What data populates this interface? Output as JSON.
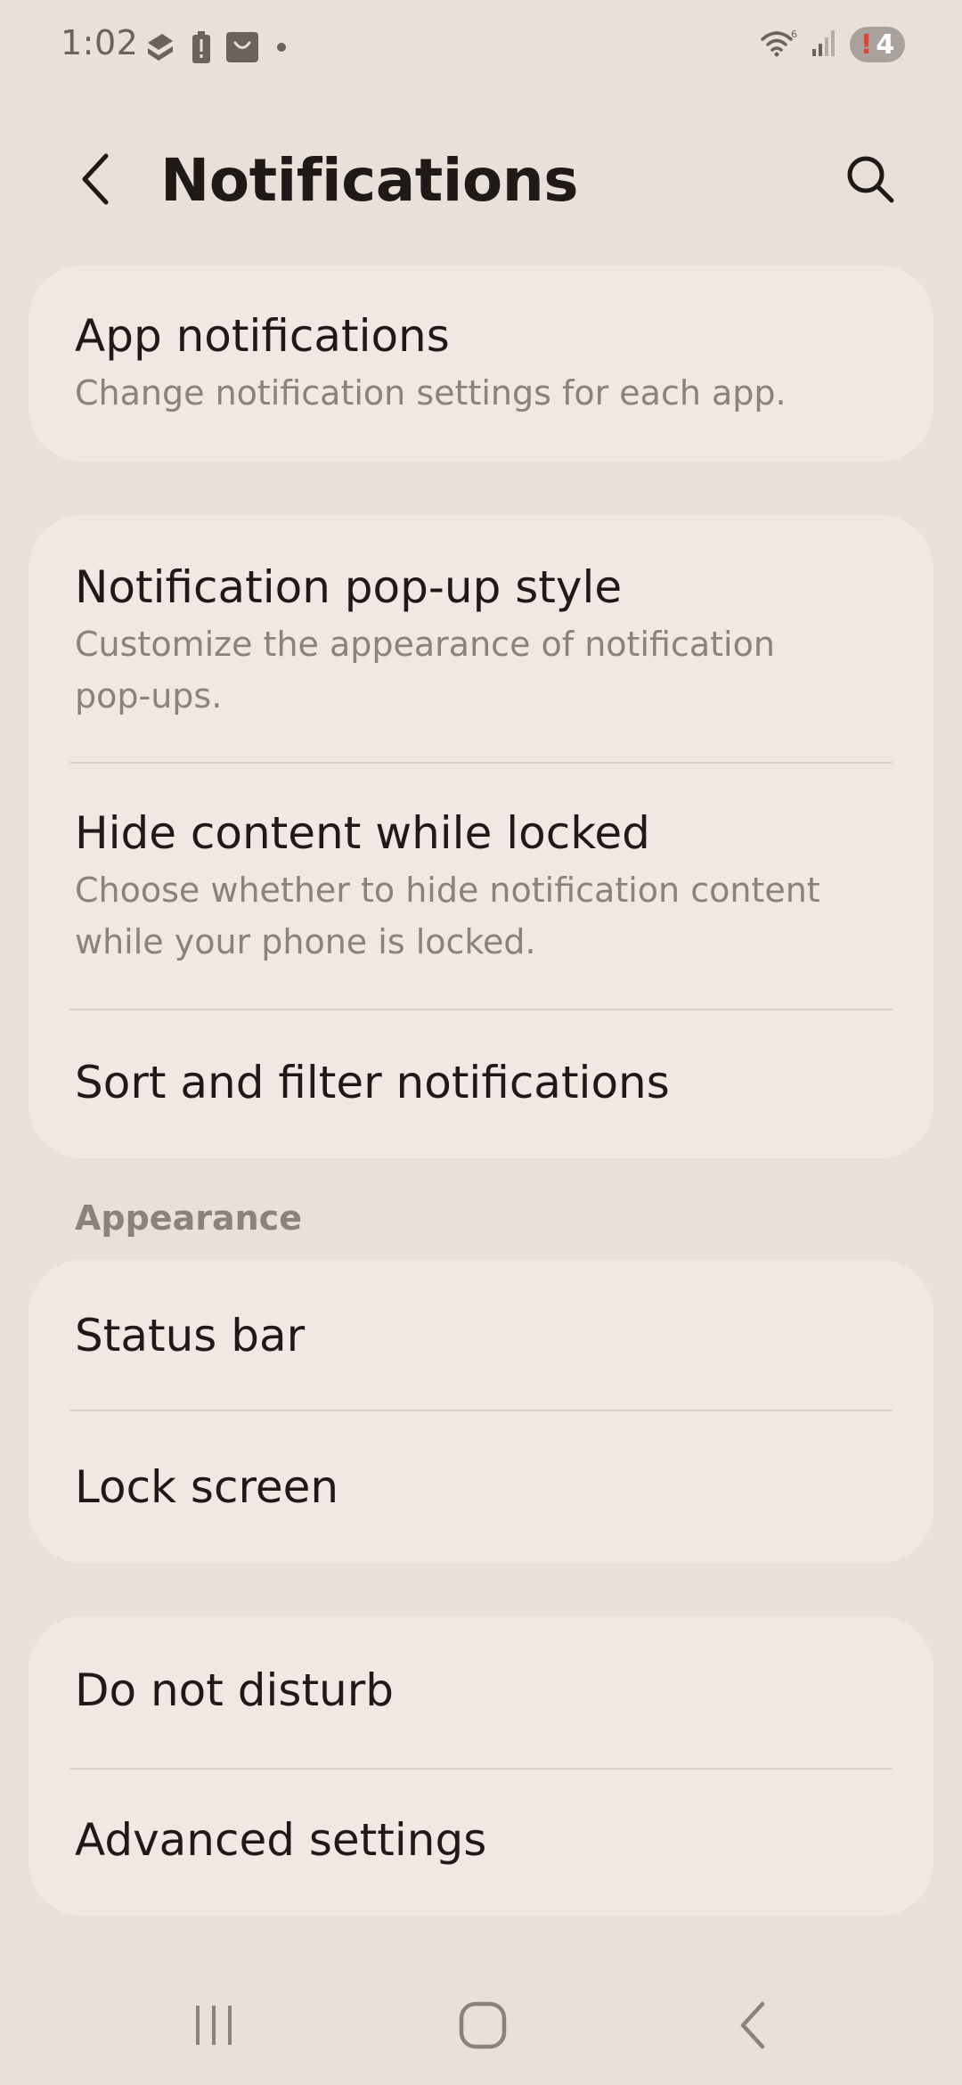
{
  "status_bar": {
    "time": "1:02",
    "battery_level": "4",
    "battery_warning": "!",
    "left_icons": [
      "authenticator-icon",
      "battery-alert-icon",
      "shopping-bag-icon",
      "dot-icon"
    ],
    "right_icons": [
      "wifi-icon",
      "signal-icon"
    ]
  },
  "header": {
    "title": "Notifications",
    "back_icon": "back-arrow-icon",
    "search_icon": "search-icon"
  },
  "cards": {
    "app_notifications": {
      "title": "App notifications",
      "subtitle": "Change notification settings for each app."
    },
    "popup_style": {
      "title": "Notification pop-up style",
      "subtitle_line1": "Customize the appearance of notification",
      "subtitle_line2": "pop-ups."
    },
    "hide_content": {
      "title": "Hide content while locked",
      "subtitle_line1": "Choose whether to hide notification content",
      "subtitle_line2": "while your phone is locked."
    },
    "sort_filter": {
      "title": "Sort and filter notifications"
    }
  },
  "appearance": {
    "header": "Appearance",
    "status_bar": "Status bar",
    "lock_screen": "Lock screen"
  },
  "more": {
    "do_not_disturb": "Do not disturb",
    "advanced_settings": "Advanced settings"
  },
  "nav_bar": {
    "recents_icon": "recents-icon",
    "home_icon": "home-icon",
    "back_icon": "back-icon"
  },
  "colors": {
    "background": "#e9e0d9",
    "card": "#f1e7e3",
    "text_primary": "#1f1a17",
    "text_secondary": "#8a827d",
    "divider": "#d8cfca",
    "battery_warning": "#e0432f"
  }
}
